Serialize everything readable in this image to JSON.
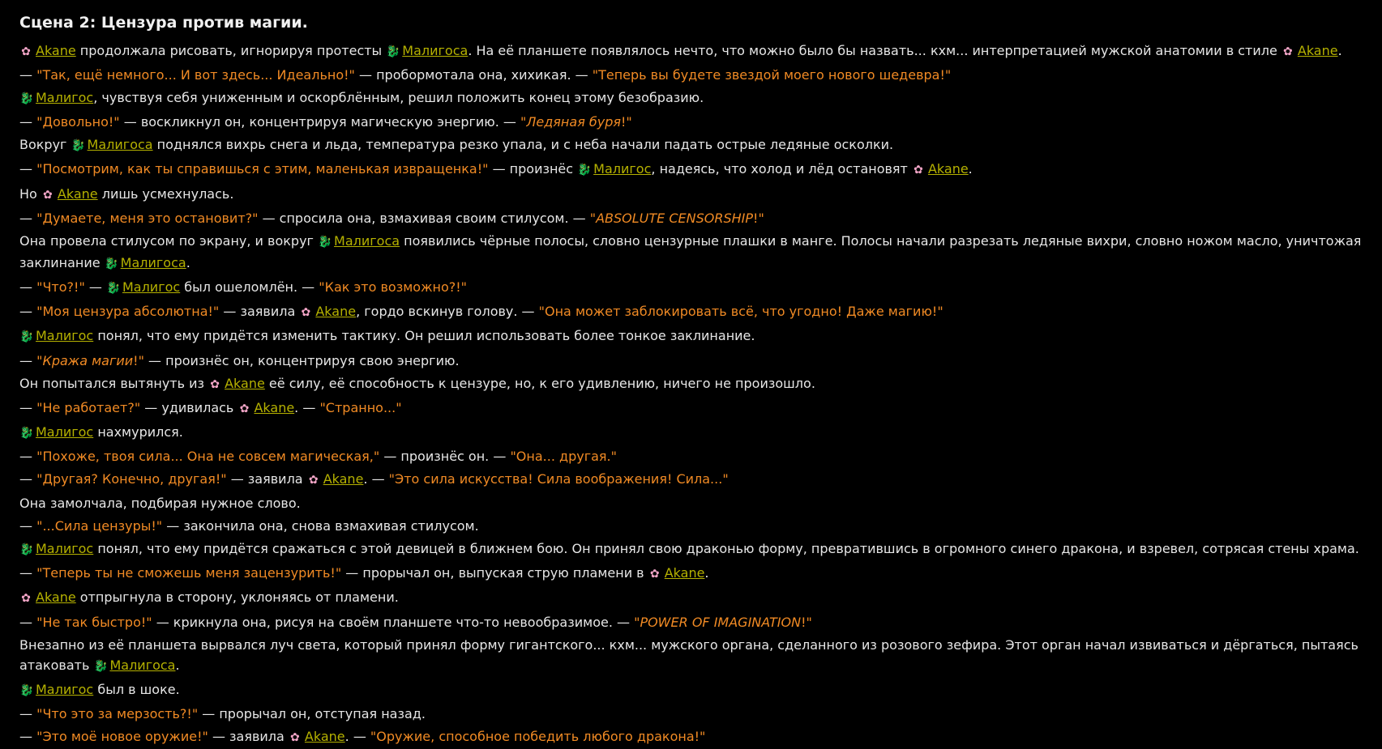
{
  "icons": {
    "flower": "flower-icon",
    "dragon": "dragon-icon"
  },
  "colors": {
    "background": "#000000",
    "text": "#e6e6e6",
    "quote": "#f08a24",
    "name": "#b5b100"
  },
  "names": {
    "akane": "Akane",
    "maligos": "Малигос",
    "maligosa": "Малигоса"
  },
  "story": {
    "title": "Сцена 2: Цензура против магии.",
    "lines": [
      [
        {
          "k": "ico",
          "v": "flower"
        },
        {
          "k": "name",
          "v": "akane"
        },
        {
          "k": "t",
          "v": " продолжала рисовать, игнорируя протесты "
        },
        {
          "k": "ico",
          "v": "dragon"
        },
        {
          "k": "name",
          "v": "maligosa"
        },
        {
          "k": "t",
          "v": ". На её планшете появлялось нечто, что можно было бы назвать... кхм... интерпретацией мужской анатомии в стиле "
        },
        {
          "k": "ico",
          "v": "flower"
        },
        {
          "k": "name",
          "v": "akane"
        },
        {
          "k": "t",
          "v": "."
        }
      ],
      [
        {
          "k": "t",
          "v": "— "
        },
        {
          "k": "q",
          "v": "\"Так, ещё немного... И вот здесь... Идеально!\""
        },
        {
          "k": "t",
          "v": " — пробормотала она, хихикая. — "
        },
        {
          "k": "q",
          "v": "\"Теперь вы будете звездой моего нового шедевра!\""
        }
      ],
      [
        {
          "k": "ico",
          "v": "dragon"
        },
        {
          "k": "name",
          "v": "maligos"
        },
        {
          "k": "t",
          "v": ", чувствуя себя униженным и оскорблённым, решил положить конец этому безобразию."
        }
      ],
      [
        {
          "k": "t",
          "v": "— "
        },
        {
          "k": "q",
          "v": "\"Довольно!\""
        },
        {
          "k": "t",
          "v": " — воскликнул он, концентрируя магическую энергию. — "
        },
        {
          "k": "q",
          "v": "\""
        },
        {
          "k": "qi",
          "v": "Ледяная буря"
        },
        {
          "k": "q",
          "v": "!\""
        }
      ],
      [
        {
          "k": "t",
          "v": "Вокруг "
        },
        {
          "k": "ico",
          "v": "dragon"
        },
        {
          "k": "name",
          "v": "maligosa"
        },
        {
          "k": "t",
          "v": " поднялся вихрь снега и льда, температура резко упала, и с неба начали падать острые ледяные осколки."
        }
      ],
      [
        {
          "k": "t",
          "v": "— "
        },
        {
          "k": "q",
          "v": "\"Посмотрим, как ты справишься с этим, маленькая извращенка!\""
        },
        {
          "k": "t",
          "v": " — произнёс "
        },
        {
          "k": "ico",
          "v": "dragon"
        },
        {
          "k": "name",
          "v": "maligos"
        },
        {
          "k": "t",
          "v": ", надеясь, что холод и лёд остановят "
        },
        {
          "k": "ico",
          "v": "flower"
        },
        {
          "k": "name",
          "v": "akane"
        },
        {
          "k": "t",
          "v": "."
        }
      ],
      [
        {
          "k": "t",
          "v": "Но "
        },
        {
          "k": "ico",
          "v": "flower"
        },
        {
          "k": "name",
          "v": "akane"
        },
        {
          "k": "t",
          "v": " лишь усмехнулась."
        }
      ],
      [
        {
          "k": "t",
          "v": "— "
        },
        {
          "k": "q",
          "v": "\"Думаете, меня это остановит?\""
        },
        {
          "k": "t",
          "v": " — спросила она, взмахивая своим стилусом. — "
        },
        {
          "k": "q",
          "v": "\""
        },
        {
          "k": "qi",
          "v": "ABSOLUTE CENSORSHIP"
        },
        {
          "k": "q",
          "v": "!\""
        }
      ],
      [
        {
          "k": "t",
          "v": "Она провела стилусом по экрану, и вокруг "
        },
        {
          "k": "ico",
          "v": "dragon"
        },
        {
          "k": "name",
          "v": "maligosa"
        },
        {
          "k": "t",
          "v": " появились чёрные полосы, словно цензурные плашки в манге. Полосы начали разрезать ледяные вихри, словно ножом масло, уничтожая заклинание "
        },
        {
          "k": "ico",
          "v": "dragon"
        },
        {
          "k": "name",
          "v": "maligosa"
        },
        {
          "k": "t",
          "v": "."
        }
      ],
      [
        {
          "k": "t",
          "v": "— "
        },
        {
          "k": "q",
          "v": "\"Что?!\""
        },
        {
          "k": "t",
          "v": " — "
        },
        {
          "k": "ico",
          "v": "dragon"
        },
        {
          "k": "name",
          "v": "maligos"
        },
        {
          "k": "t",
          "v": " был ошеломлён. — "
        },
        {
          "k": "q",
          "v": "\"Как это возможно?!\""
        }
      ],
      [
        {
          "k": "t",
          "v": "— "
        },
        {
          "k": "q",
          "v": "\"Моя цензура абсолютна!\""
        },
        {
          "k": "t",
          "v": " — заявила "
        },
        {
          "k": "ico",
          "v": "flower"
        },
        {
          "k": "name",
          "v": "akane"
        },
        {
          "k": "t",
          "v": ", гордо вскинув голову. — "
        },
        {
          "k": "q",
          "v": "\"Она может заблокировать всё, что угодно! Даже магию!\""
        }
      ],
      [
        {
          "k": "ico",
          "v": "dragon"
        },
        {
          "k": "name",
          "v": "maligos"
        },
        {
          "k": "t",
          "v": " понял, что ему придётся изменить тактику. Он решил использовать более тонкое заклинание."
        }
      ],
      [
        {
          "k": "t",
          "v": "— "
        },
        {
          "k": "q",
          "v": "\""
        },
        {
          "k": "qi",
          "v": "Кража магии"
        },
        {
          "k": "q",
          "v": "!\""
        },
        {
          "k": "t",
          "v": " — произнёс он, концентрируя свою энергию."
        }
      ],
      [
        {
          "k": "t",
          "v": "Он попытался вытянуть из "
        },
        {
          "k": "ico",
          "v": "flower"
        },
        {
          "k": "name",
          "v": "akane"
        },
        {
          "k": "t",
          "v": " её силу, её способность к цензуре, но, к его удивлению, ничего не произошло."
        }
      ],
      [
        {
          "k": "t",
          "v": "— "
        },
        {
          "k": "q",
          "v": "\"Не работает?\""
        },
        {
          "k": "t",
          "v": " — удивилась "
        },
        {
          "k": "ico",
          "v": "flower"
        },
        {
          "k": "name",
          "v": "akane"
        },
        {
          "k": "t",
          "v": ". — "
        },
        {
          "k": "q",
          "v": "\"Странно...\""
        }
      ],
      [
        {
          "k": "ico",
          "v": "dragon"
        },
        {
          "k": "name",
          "v": "maligos"
        },
        {
          "k": "t",
          "v": " нахмурился."
        }
      ],
      [
        {
          "k": "t",
          "v": "— "
        },
        {
          "k": "q",
          "v": "\"Похоже, твоя сила... Она не совсем магическая,\""
        },
        {
          "k": "t",
          "v": " — произнёс он. — "
        },
        {
          "k": "q",
          "v": "\"Она... другая.\""
        }
      ],
      [
        {
          "k": "t",
          "v": "— "
        },
        {
          "k": "q",
          "v": "\"Другая? Конечно, другая!\""
        },
        {
          "k": "t",
          "v": " — заявила "
        },
        {
          "k": "ico",
          "v": "flower"
        },
        {
          "k": "name",
          "v": "akane"
        },
        {
          "k": "t",
          "v": ". — "
        },
        {
          "k": "q",
          "v": "\"Это сила искусства! Сила воображения! Сила...\""
        }
      ],
      [
        {
          "k": "t",
          "v": "Она замолчала, подбирая нужное слово."
        }
      ],
      [
        {
          "k": "t",
          "v": "— "
        },
        {
          "k": "q",
          "v": "\"...Сила цензуры!\""
        },
        {
          "k": "t",
          "v": " — закончила она, снова взмахивая стилусом."
        }
      ],
      [
        {
          "k": "ico",
          "v": "dragon"
        },
        {
          "k": "name",
          "v": "maligos"
        },
        {
          "k": "t",
          "v": " понял, что ему придётся сражаться с этой девицей в ближнем бою. Он принял свою драконью форму, превратившись в огромного синего дракона, и взревел, сотрясая стены храма."
        }
      ],
      [
        {
          "k": "t",
          "v": "— "
        },
        {
          "k": "q",
          "v": "\"Теперь ты не сможешь меня зацензурить!\""
        },
        {
          "k": "t",
          "v": " — прорычал он, выпуская струю пламени в "
        },
        {
          "k": "ico",
          "v": "flower"
        },
        {
          "k": "name",
          "v": "akane"
        },
        {
          "k": "t",
          "v": "."
        }
      ],
      [
        {
          "k": "ico",
          "v": "flower"
        },
        {
          "k": "name",
          "v": "akane"
        },
        {
          "k": "t",
          "v": " отпрыгнула в сторону, уклоняясь от пламени."
        }
      ],
      [
        {
          "k": "t",
          "v": "— "
        },
        {
          "k": "q",
          "v": "\"Не так быстро!\""
        },
        {
          "k": "t",
          "v": " — крикнула она, рисуя на своём планшете что-то невообразимое. — "
        },
        {
          "k": "q",
          "v": "\""
        },
        {
          "k": "qi",
          "v": "POWER OF IMAGINATION"
        },
        {
          "k": "q",
          "v": "!\""
        }
      ],
      [
        {
          "k": "t",
          "v": "Внезапно из её планшета вырвался луч света, который принял форму гигантского... кхм... мужского органа, сделанного из розового зефира. Этот орган начал извиваться и дёргаться, пытаясь атаковать "
        },
        {
          "k": "ico",
          "v": "dragon"
        },
        {
          "k": "name",
          "v": "maligosa"
        },
        {
          "k": "t",
          "v": "."
        }
      ],
      [
        {
          "k": "ico",
          "v": "dragon"
        },
        {
          "k": "name",
          "v": "maligos"
        },
        {
          "k": "t",
          "v": " был в шоке."
        }
      ],
      [
        {
          "k": "t",
          "v": "— "
        },
        {
          "k": "q",
          "v": "\"Что это за мерзость?!\""
        },
        {
          "k": "t",
          "v": " — прорычал он, отступая назад."
        }
      ],
      [
        {
          "k": "t",
          "v": "— "
        },
        {
          "k": "q",
          "v": "\"Это моё новое оружие!\""
        },
        {
          "k": "t",
          "v": " — заявила "
        },
        {
          "k": "ico",
          "v": "flower"
        },
        {
          "k": "name",
          "v": "akane"
        },
        {
          "k": "t",
          "v": ". — "
        },
        {
          "k": "q",
          "v": "\"Оружие, способное победить любого дракона!\""
        }
      ]
    ]
  }
}
